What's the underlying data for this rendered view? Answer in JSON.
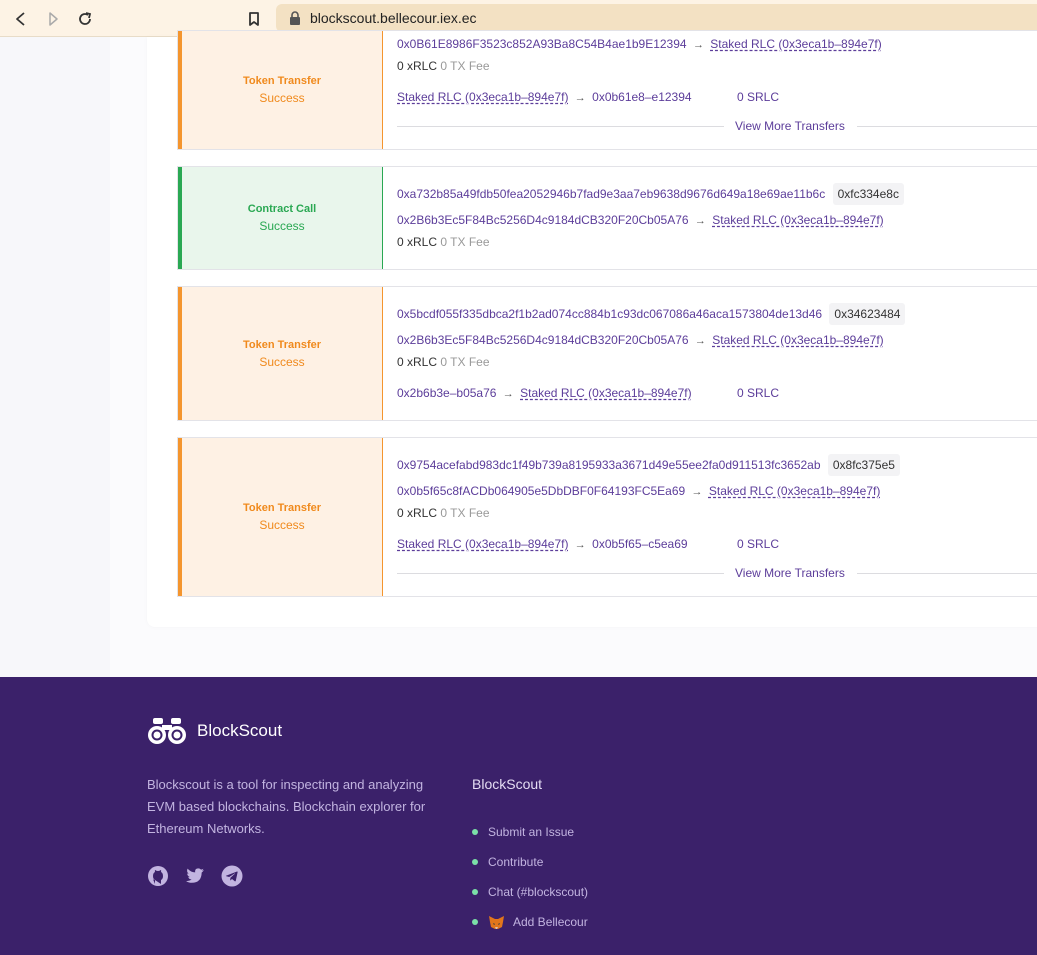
{
  "browser": {
    "url": "blockscout.bellecour.iex.ec"
  },
  "transactions": [
    {
      "type": "Token Transfer",
      "status": "Success",
      "from": "0x0B61E8986F3523c852A93Ba8C54B4ae1b9E12394",
      "to": "Staked RLC (0x3eca1b–894e7f)",
      "value": "0 xRLC",
      "fee": "0 TX Fee",
      "transfer_from": "Staked RLC (0x3eca1b–894e7f)",
      "transfer_to": "0x0b61e8–e12394",
      "transfer_amount": "0 SRLC",
      "view_more": "View More Transfers"
    },
    {
      "type": "Contract Call",
      "status": "Success",
      "hash": "0xa732b85a49fdb50fea2052946b7fad9e3aa7eb9638d9676d649a18e69ae11b6c",
      "block": "0xfc334e8c",
      "from": "0x2B6b3Ec5F84Bc5256D4c9184dCB320F20Cb05A76",
      "to": "Staked RLC (0x3eca1b–894e7f)",
      "value": "0 xRLC",
      "fee": "0 TX Fee"
    },
    {
      "type": "Token Transfer",
      "status": "Success",
      "hash": "0x5bcdf055f335dbca2f1b2ad074cc884b1c93dc067086a46aca1573804de13d46",
      "block": "0x34623484",
      "from": "0x2B6b3Ec5F84Bc5256D4c9184dCB320F20Cb05A76",
      "to": "Staked RLC (0x3eca1b–894e7f)",
      "value": "0 xRLC",
      "fee": "0 TX Fee",
      "transfer_from": "0x2b6b3e–b05a76",
      "transfer_to": "Staked RLC (0x3eca1b–894e7f)",
      "transfer_amount": "0 SRLC"
    },
    {
      "type": "Token Transfer",
      "status": "Success",
      "hash": "0x9754acefabd983dc1f49b739a8195933a3671d49e55ee2fa0d911513fc3652ab",
      "block": "0x8fc375e5",
      "from": "0x0b5f65c8fACDb064905e5DbDBF0F64193FC5Ea69",
      "to": "Staked RLC (0x3eca1b–894e7f)",
      "value": "0 xRLC",
      "fee": "0 TX Fee",
      "transfer_from": "Staked RLC (0x3eca1b–894e7f)",
      "transfer_to": "0x0b5f65–c5ea69",
      "transfer_amount": "0 SRLC",
      "view_more": "View More Transfers"
    }
  ],
  "footer": {
    "brand": "BlockScout",
    "description": "Blockscout is a tool for inspecting and analyzing EVM based blockchains. Blockchain explorer for Ethereum Networks.",
    "column_title": "BlockScout",
    "links": [
      "Submit an Issue",
      "Contribute",
      "Chat (#blockscout)",
      "Add Bellecour"
    ]
  },
  "colors": {
    "accent": "#5c3d9a",
    "footer_bg": "#3b216a",
    "token_transfer": "#f08a1d",
    "contract_call": "#2aa853"
  }
}
